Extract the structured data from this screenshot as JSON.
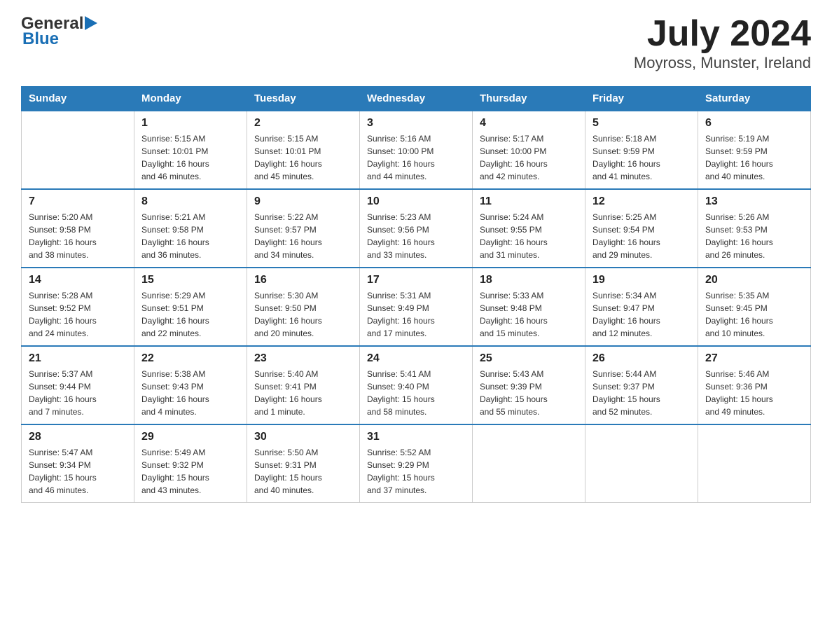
{
  "header": {
    "title": "July 2024",
    "subtitle": "Moyross, Munster, Ireland",
    "logo_general": "General",
    "logo_blue": "Blue"
  },
  "days_of_week": [
    "Sunday",
    "Monday",
    "Tuesday",
    "Wednesday",
    "Thursday",
    "Friday",
    "Saturday"
  ],
  "weeks": [
    [
      {
        "day": "",
        "info": ""
      },
      {
        "day": "1",
        "info": "Sunrise: 5:15 AM\nSunset: 10:01 PM\nDaylight: 16 hours\nand 46 minutes."
      },
      {
        "day": "2",
        "info": "Sunrise: 5:15 AM\nSunset: 10:01 PM\nDaylight: 16 hours\nand 45 minutes."
      },
      {
        "day": "3",
        "info": "Sunrise: 5:16 AM\nSunset: 10:00 PM\nDaylight: 16 hours\nand 44 minutes."
      },
      {
        "day": "4",
        "info": "Sunrise: 5:17 AM\nSunset: 10:00 PM\nDaylight: 16 hours\nand 42 minutes."
      },
      {
        "day": "5",
        "info": "Sunrise: 5:18 AM\nSunset: 9:59 PM\nDaylight: 16 hours\nand 41 minutes."
      },
      {
        "day": "6",
        "info": "Sunrise: 5:19 AM\nSunset: 9:59 PM\nDaylight: 16 hours\nand 40 minutes."
      }
    ],
    [
      {
        "day": "7",
        "info": "Sunrise: 5:20 AM\nSunset: 9:58 PM\nDaylight: 16 hours\nand 38 minutes."
      },
      {
        "day": "8",
        "info": "Sunrise: 5:21 AM\nSunset: 9:58 PM\nDaylight: 16 hours\nand 36 minutes."
      },
      {
        "day": "9",
        "info": "Sunrise: 5:22 AM\nSunset: 9:57 PM\nDaylight: 16 hours\nand 34 minutes."
      },
      {
        "day": "10",
        "info": "Sunrise: 5:23 AM\nSunset: 9:56 PM\nDaylight: 16 hours\nand 33 minutes."
      },
      {
        "day": "11",
        "info": "Sunrise: 5:24 AM\nSunset: 9:55 PM\nDaylight: 16 hours\nand 31 minutes."
      },
      {
        "day": "12",
        "info": "Sunrise: 5:25 AM\nSunset: 9:54 PM\nDaylight: 16 hours\nand 29 minutes."
      },
      {
        "day": "13",
        "info": "Sunrise: 5:26 AM\nSunset: 9:53 PM\nDaylight: 16 hours\nand 26 minutes."
      }
    ],
    [
      {
        "day": "14",
        "info": "Sunrise: 5:28 AM\nSunset: 9:52 PM\nDaylight: 16 hours\nand 24 minutes."
      },
      {
        "day": "15",
        "info": "Sunrise: 5:29 AM\nSunset: 9:51 PM\nDaylight: 16 hours\nand 22 minutes."
      },
      {
        "day": "16",
        "info": "Sunrise: 5:30 AM\nSunset: 9:50 PM\nDaylight: 16 hours\nand 20 minutes."
      },
      {
        "day": "17",
        "info": "Sunrise: 5:31 AM\nSunset: 9:49 PM\nDaylight: 16 hours\nand 17 minutes."
      },
      {
        "day": "18",
        "info": "Sunrise: 5:33 AM\nSunset: 9:48 PM\nDaylight: 16 hours\nand 15 minutes."
      },
      {
        "day": "19",
        "info": "Sunrise: 5:34 AM\nSunset: 9:47 PM\nDaylight: 16 hours\nand 12 minutes."
      },
      {
        "day": "20",
        "info": "Sunrise: 5:35 AM\nSunset: 9:45 PM\nDaylight: 16 hours\nand 10 minutes."
      }
    ],
    [
      {
        "day": "21",
        "info": "Sunrise: 5:37 AM\nSunset: 9:44 PM\nDaylight: 16 hours\nand 7 minutes."
      },
      {
        "day": "22",
        "info": "Sunrise: 5:38 AM\nSunset: 9:43 PM\nDaylight: 16 hours\nand 4 minutes."
      },
      {
        "day": "23",
        "info": "Sunrise: 5:40 AM\nSunset: 9:41 PM\nDaylight: 16 hours\nand 1 minute."
      },
      {
        "day": "24",
        "info": "Sunrise: 5:41 AM\nSunset: 9:40 PM\nDaylight: 15 hours\nand 58 minutes."
      },
      {
        "day": "25",
        "info": "Sunrise: 5:43 AM\nSunset: 9:39 PM\nDaylight: 15 hours\nand 55 minutes."
      },
      {
        "day": "26",
        "info": "Sunrise: 5:44 AM\nSunset: 9:37 PM\nDaylight: 15 hours\nand 52 minutes."
      },
      {
        "day": "27",
        "info": "Sunrise: 5:46 AM\nSunset: 9:36 PM\nDaylight: 15 hours\nand 49 minutes."
      }
    ],
    [
      {
        "day": "28",
        "info": "Sunrise: 5:47 AM\nSunset: 9:34 PM\nDaylight: 15 hours\nand 46 minutes."
      },
      {
        "day": "29",
        "info": "Sunrise: 5:49 AM\nSunset: 9:32 PM\nDaylight: 15 hours\nand 43 minutes."
      },
      {
        "day": "30",
        "info": "Sunrise: 5:50 AM\nSunset: 9:31 PM\nDaylight: 15 hours\nand 40 minutes."
      },
      {
        "day": "31",
        "info": "Sunrise: 5:52 AM\nSunset: 9:29 PM\nDaylight: 15 hours\nand 37 minutes."
      },
      {
        "day": "",
        "info": ""
      },
      {
        "day": "",
        "info": ""
      },
      {
        "day": "",
        "info": ""
      }
    ]
  ]
}
